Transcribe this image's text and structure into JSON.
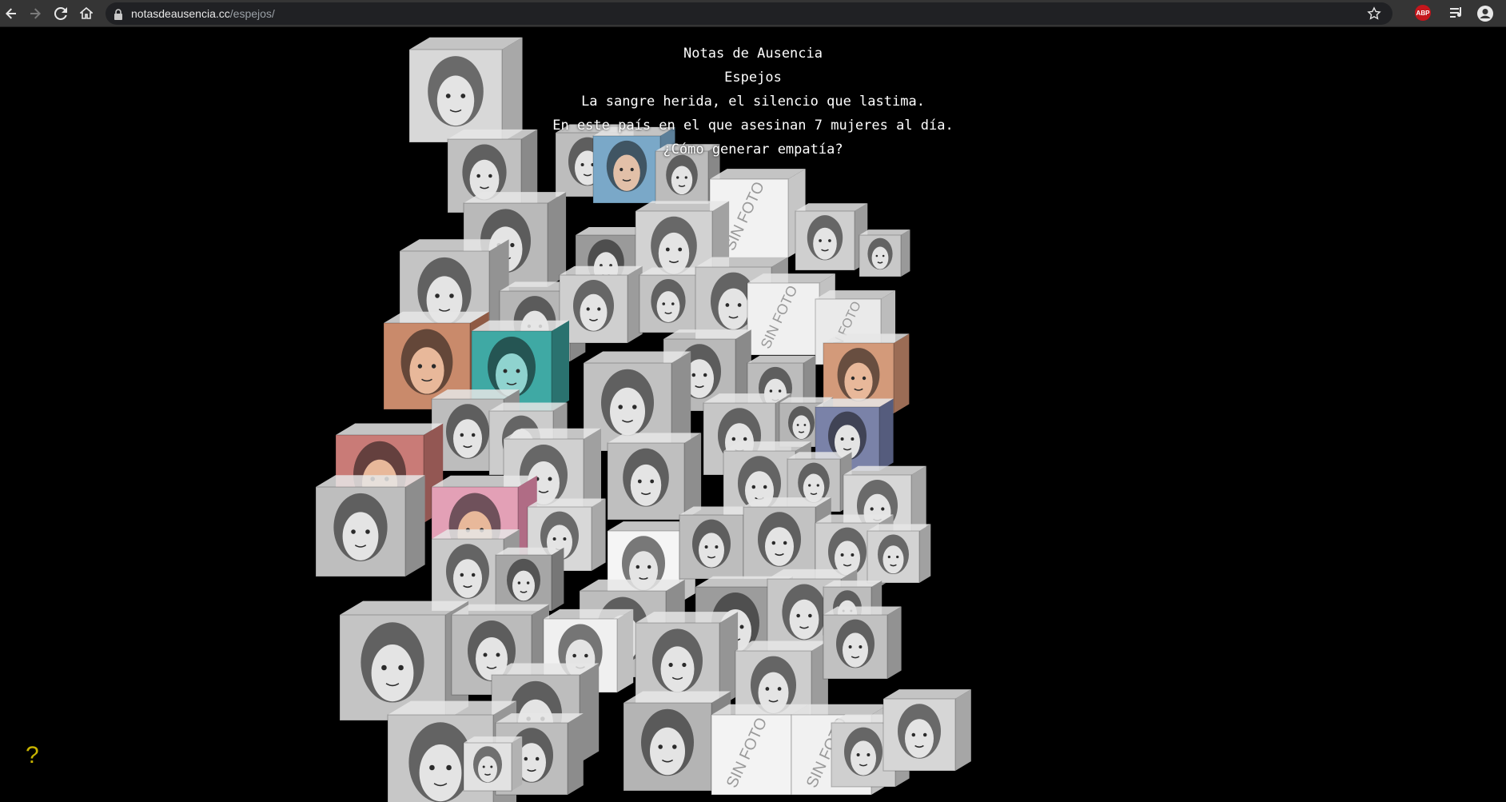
{
  "browser": {
    "url_host": "notasdeausencia.cc",
    "url_path": "/espejos/",
    "icons": [
      "back-icon",
      "forward-icon",
      "reload-icon",
      "home-icon",
      "lock-icon",
      "star-icon",
      "adblock-plus-icon",
      "media-queue-icon",
      "profile-icon"
    ],
    "extension_label": "ABP"
  },
  "header": {
    "title": "Notas de Ausencia",
    "subtitle": "Espejos",
    "line1": "La sangre herida, el silencio que lastima.",
    "line2": "En este país en el que asesinan 7 mujeres al día.",
    "line3": "¿Cómo generar empatía?"
  },
  "gallery": {
    "placeholder_text": "SIN FOTO",
    "photo_count": 78
  },
  "help": {
    "label": "?"
  },
  "colors": {
    "background": "#000000",
    "text": "#ffffff",
    "help": "#c8b400",
    "abp": "#c4161c"
  }
}
